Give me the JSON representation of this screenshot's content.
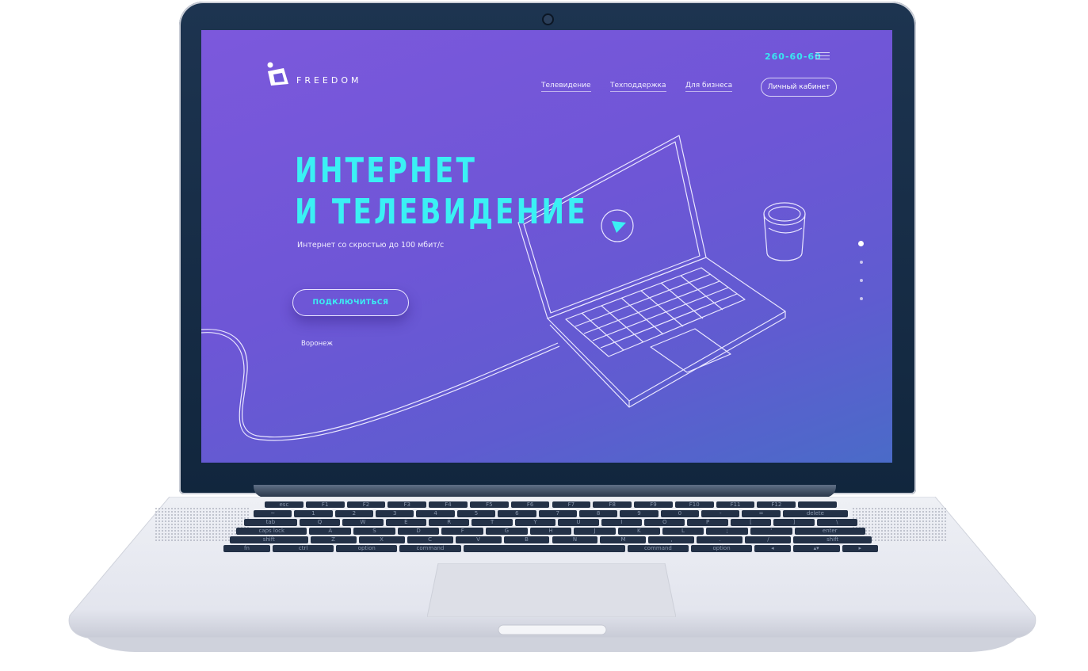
{
  "brand": {
    "name": "FREEDOM"
  },
  "header": {
    "phone": "260-60-60",
    "nav": [
      {
        "label": "Телевидение"
      },
      {
        "label": "Техподдержка"
      },
      {
        "label": "Для бизнеса"
      }
    ],
    "account_button": "Личный кабинет"
  },
  "hero": {
    "title_line1": "ИНТЕРНЕТ",
    "title_line2": "И ТЕЛЕВИДЕНИЕ",
    "subtitle": "Интернет со скростью до 100 мбит/с",
    "cta": "ПОДКЛЮЧИТЬСЯ",
    "city": "Воронеж"
  },
  "slider": {
    "count": 4,
    "active_index": 0
  },
  "colors": {
    "accent": "#3af1f4",
    "bg_top": "#7c58dc",
    "bg_bottom": "#4a6bc8"
  },
  "keyboard": {
    "rows": [
      [
        "esc",
        "F1",
        "F2",
        "F3",
        "F4",
        "F5",
        "F6",
        "F7",
        "F8",
        "F9",
        "F10",
        "F11",
        "F12",
        ""
      ],
      [
        "~",
        "1",
        "2",
        "3",
        "4",
        "5",
        "6",
        "7",
        "8",
        "9",
        "0",
        "-",
        "=",
        "delete"
      ],
      [
        "tab",
        "Q",
        "W",
        "E",
        "R",
        "T",
        "Y",
        "U",
        "I",
        "O",
        "P",
        "[",
        "]",
        "\\"
      ],
      [
        "caps lock",
        "A",
        "S",
        "D",
        "F",
        "G",
        "H",
        "J",
        "K",
        "L",
        ";",
        "'",
        "enter"
      ],
      [
        "shift",
        "Z",
        "X",
        "C",
        "V",
        "B",
        "N",
        "M",
        ",",
        ".",
        "/",
        "shift"
      ],
      [
        "fn",
        "ctrl",
        "option",
        "command",
        "",
        "command",
        "option",
        "◂",
        "▴▾",
        "▸"
      ]
    ]
  }
}
